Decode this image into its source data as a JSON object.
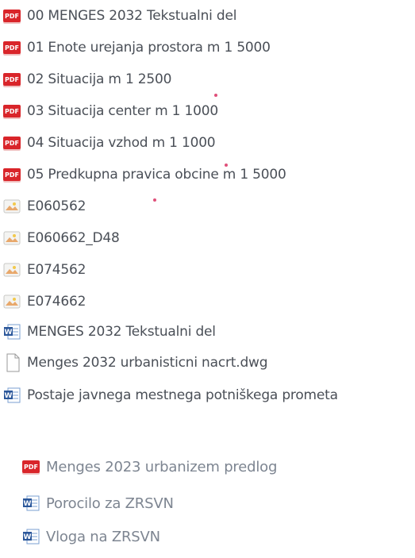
{
  "files": [
    {
      "name": "00 MENGES 2032 Tekstualni del",
      "icon": "pdf-icon"
    },
    {
      "name": "01 Enote urejanja prostora m 1 5000",
      "icon": "pdf-icon"
    },
    {
      "name": "02 Situacija m 1 2500",
      "icon": "pdf-icon"
    },
    {
      "name": "03 Situacija center m 1 1000",
      "icon": "pdf-icon"
    },
    {
      "name": "04 Situacija vzhod m 1 1000",
      "icon": "pdf-icon"
    },
    {
      "name": "05 Predkupna pravica obcine m 1 5000",
      "icon": "pdf-icon"
    },
    {
      "name": "E060562",
      "icon": "image-icon"
    },
    {
      "name": "E060662_D48",
      "icon": "image-icon"
    },
    {
      "name": "E074562",
      "icon": "image-icon"
    },
    {
      "name": "E074662",
      "icon": "image-icon"
    },
    {
      "name": "MENGES 2032 Tekstualni del",
      "icon": "word-icon"
    },
    {
      "name": "Menges 2032 urbanisticni nacrt.dwg",
      "icon": "file-icon"
    },
    {
      "name": "Postaje javnega mestnega potniškega prometa",
      "icon": "word-icon"
    }
  ],
  "extra_files": [
    {
      "name": "Menges 2023 urbanizem predlog",
      "icon": "pdf-icon"
    },
    {
      "name": "Porocilo za ZRSVN",
      "icon": "word-icon"
    },
    {
      "name": "Vloga na ZRSVN",
      "icon": "word-icon"
    }
  ],
  "icon_badge": {
    "pdf": "PDF"
  },
  "colors": {
    "pdf": "#d9252a",
    "word": "#2b579a",
    "text": "#4a4f57",
    "text_faded": "#7d8591"
  }
}
